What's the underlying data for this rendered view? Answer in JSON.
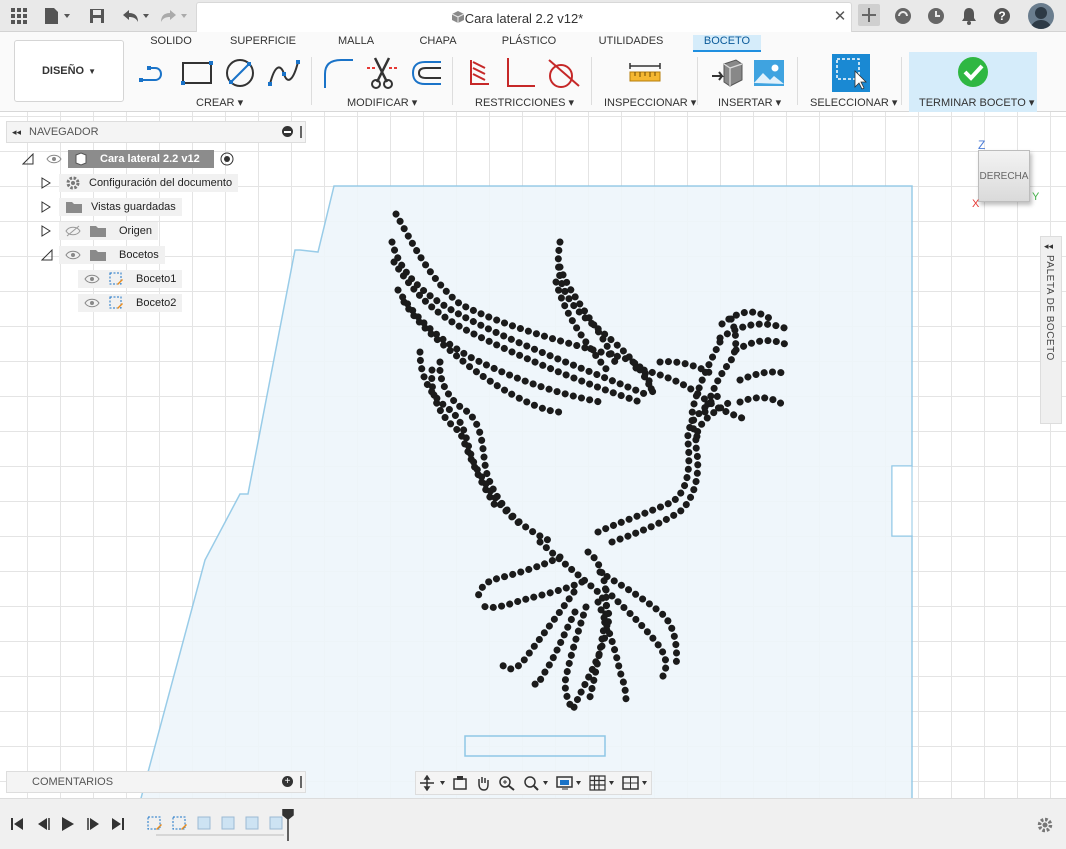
{
  "window": {
    "doc_title": "Cara lateral 2.2 v12*"
  },
  "ribbon": {
    "workspace_label": "DISEÑO",
    "tabs": [
      "SOLIDO",
      "SUPERFICIE",
      "MALLA",
      "CHAPA",
      "PLÁSTICO",
      "UTILIDADES",
      "BOCETO"
    ],
    "active_tab": "BOCETO",
    "groups": {
      "crear": "CREAR",
      "modificar": "MODIFICAR",
      "restricciones": "RESTRICCIONES",
      "inspeccionar": "INSPECCIONAR",
      "insertar": "INSERTAR",
      "seleccionar": "SELECCIONAR",
      "terminar": "TERMINAR BOCETO"
    },
    "colors": {
      "active_tab_bg": "#d5ecfa",
      "finish_green": "#2fb742",
      "accent": "#1f8fe0"
    }
  },
  "browser": {
    "title": "NAVEGADOR",
    "root": "Cara lateral 2.2 v12",
    "items": [
      "Configuración del documento",
      "Vistas guardadas",
      "Origen",
      "Bocetos"
    ],
    "sketches": [
      "Boceto1",
      "Boceto2"
    ]
  },
  "comments": {
    "title": "COMENTARIOS"
  },
  "viewcube": {
    "face": "DERECHA",
    "axes": {
      "z": "Z",
      "x": "X",
      "y": "Y"
    }
  },
  "palette": {
    "label": "PALETA DE BOCETO"
  }
}
